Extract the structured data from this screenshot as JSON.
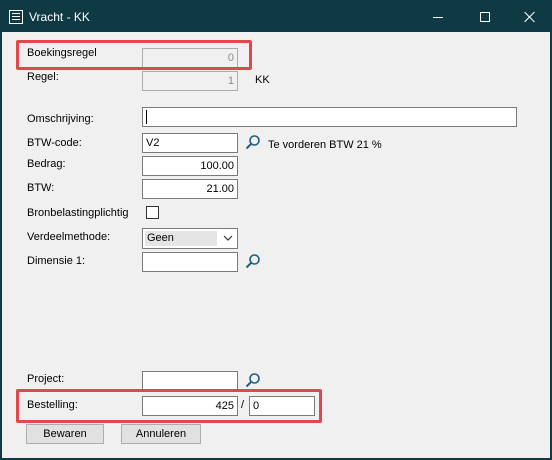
{
  "window": {
    "title": "Vracht - KK"
  },
  "form": {
    "boekingsregel_label": "Boekingsregel",
    "boekingsregel_value": "0",
    "regel_label": "Regel:",
    "regel_value": "1",
    "regel_suffix": "KK",
    "omschrijving_label": "Omschrijving:",
    "omschrijving_value": "",
    "btw_code_label": "BTW-code:",
    "btw_code_value": "V2",
    "btw_code_desc": "Te vorderen BTW 21 %",
    "bedrag_label": "Bedrag:",
    "bedrag_value": "100.00",
    "btw_label": "BTW:",
    "btw_value": "21.00",
    "bronbelasting_label": "Bronbelastingplichtig",
    "bronbelasting_checked": false,
    "verdeelmethode_label": "Verdeelmethode:",
    "verdeelmethode_value": "Geen",
    "dimensie_label": "Dimensie 1:",
    "dimensie_value": "",
    "project_label": "Project:",
    "project_value": "",
    "bestelling_label": "Bestelling:",
    "bestelling_value": "425",
    "bestelling_separator": "/",
    "bestelling_line": "0"
  },
  "buttons": {
    "save": "Bewaren",
    "cancel": "Annuleren"
  },
  "icons": {
    "lookup": "magnifier-icon",
    "dropdown": "chevron-down-icon",
    "app": "form-icon"
  },
  "colors": {
    "titlebar": "#0f3a44",
    "highlight": "#e0484d",
    "lookup_icon": "#1f5f7a"
  }
}
